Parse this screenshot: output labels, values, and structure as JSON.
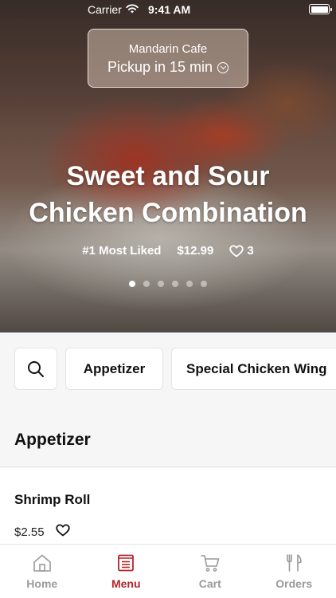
{
  "status_bar": {
    "carrier": "Carrier",
    "time": "9:41 AM"
  },
  "pickup": {
    "store_name": "Mandarin Cafe",
    "pickup_time": "Pickup in 15 min"
  },
  "hero": {
    "title_line1": "Sweet and Sour",
    "title_line2": "Chicken Combination",
    "rank": "#1 Most Liked",
    "price": "$12.99",
    "likes": "3",
    "carousel": {
      "count": 6,
      "active_index": 0
    }
  },
  "categories": {
    "search_icon": "search-icon",
    "items": [
      "Appetizer",
      "Special Chicken Wing"
    ]
  },
  "menu": {
    "section_title": "Appetizer",
    "items": [
      {
        "name": "Shrimp Roll",
        "price": "$2.55"
      }
    ]
  },
  "tab_bar": {
    "tabs": [
      {
        "label": "Home",
        "icon": "home-icon",
        "active": false
      },
      {
        "label": "Menu",
        "icon": "menu-icon",
        "active": true
      },
      {
        "label": "Cart",
        "icon": "cart-icon",
        "active": false
      },
      {
        "label": "Orders",
        "icon": "orders-icon",
        "active": false
      }
    ]
  },
  "colors": {
    "accent": "#b3262b",
    "inactive": "#9a9a9a"
  }
}
